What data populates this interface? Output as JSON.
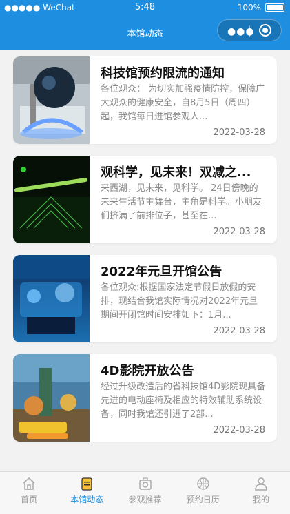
{
  "statusbar": {
    "carrier": "●●●●● WeChat",
    "time": "5:48",
    "battery": "100%"
  },
  "navbar": {
    "title": "本馆动态"
  },
  "articles": [
    {
      "title": "科技馆预约限流的通知",
      "desc": "各位观众： 为切实加强疫情防控，保障广大观众的健康安全，自8月5日（周四）起，我馆每日进馆参观人...",
      "date": "2022-03-28"
    },
    {
      "title": "观科学，见未来！双减之...",
      "desc": "来西湖，见未来，见科学。 24日傍晚的未来生活节主舞台，主角是科学。小朋友们挤满了前排位子，甚至在...",
      "date": "2022-03-28"
    },
    {
      "title": "2022年元旦开馆公告",
      "desc": "各位观众:根据国家法定节假日放假的安排，现结合我馆实际情况对2022年元旦期间开闭馆时间安排如下：1月...",
      "date": "2022-03-28"
    },
    {
      "title": "4D影院开放公告",
      "desc": "经过升级改造后的省科技馆4D影院现具备先进的电动座椅及相应的特效辅助系统设备，同时我馆还引进了2部...",
      "date": "2022-03-28"
    }
  ],
  "tabbar": {
    "items": [
      {
        "label": "首页"
      },
      {
        "label": "本馆动态"
      },
      {
        "label": "参观推荐"
      },
      {
        "label": "预约日历"
      },
      {
        "label": "我的"
      }
    ]
  },
  "colors": {
    "accent": "#1e8fe0"
  }
}
